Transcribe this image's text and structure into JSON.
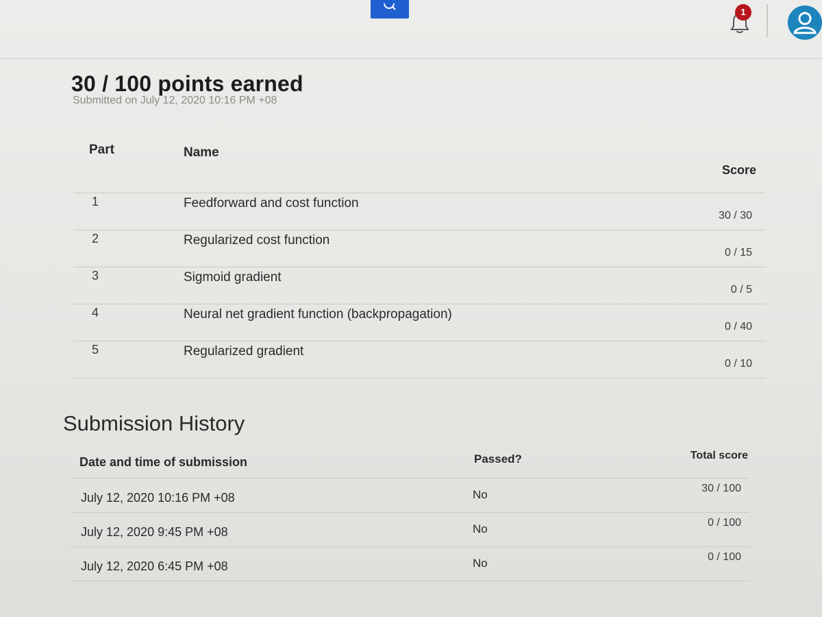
{
  "header": {
    "search_icon": "search-icon",
    "notifications": {
      "icon": "bell-icon",
      "badge_count": "1",
      "badge_color": "#b7141c"
    },
    "avatar_icon": "user-avatar-icon",
    "accent_color": "#1f5fcf"
  },
  "summary": {
    "title": "30 / 100 points earned",
    "submitted": "Submitted on July 12, 2020 10:16 PM +08"
  },
  "parts_table": {
    "headers": {
      "part": "Part",
      "name": "Name",
      "score": "Score"
    },
    "rows": [
      {
        "part": "1",
        "name": "Feedforward and cost function",
        "score": "30 / 30"
      },
      {
        "part": "2",
        "name": "Regularized cost function",
        "score": "0 / 15"
      },
      {
        "part": "3",
        "name": "Sigmoid gradient",
        "score": "0 / 5"
      },
      {
        "part": "4",
        "name": "Neural net gradient function (backpropagation)",
        "score": "0 / 40"
      },
      {
        "part": "5",
        "name": "Regularized gradient",
        "score": "0 / 10"
      }
    ]
  },
  "history": {
    "title": "Submission History",
    "headers": {
      "date": "Date and time of submission",
      "passed": "Passed?",
      "total": "Total score"
    },
    "rows": [
      {
        "date": "July 12, 2020 10:16 PM +08",
        "passed": "No",
        "total": "30 / 100"
      },
      {
        "date": "July 12, 2020 9:45 PM +08",
        "passed": "No",
        "total": "0 / 100"
      },
      {
        "date": "July 12, 2020 6:45 PM +08",
        "passed": "No",
        "total": "0 / 100"
      }
    ]
  }
}
